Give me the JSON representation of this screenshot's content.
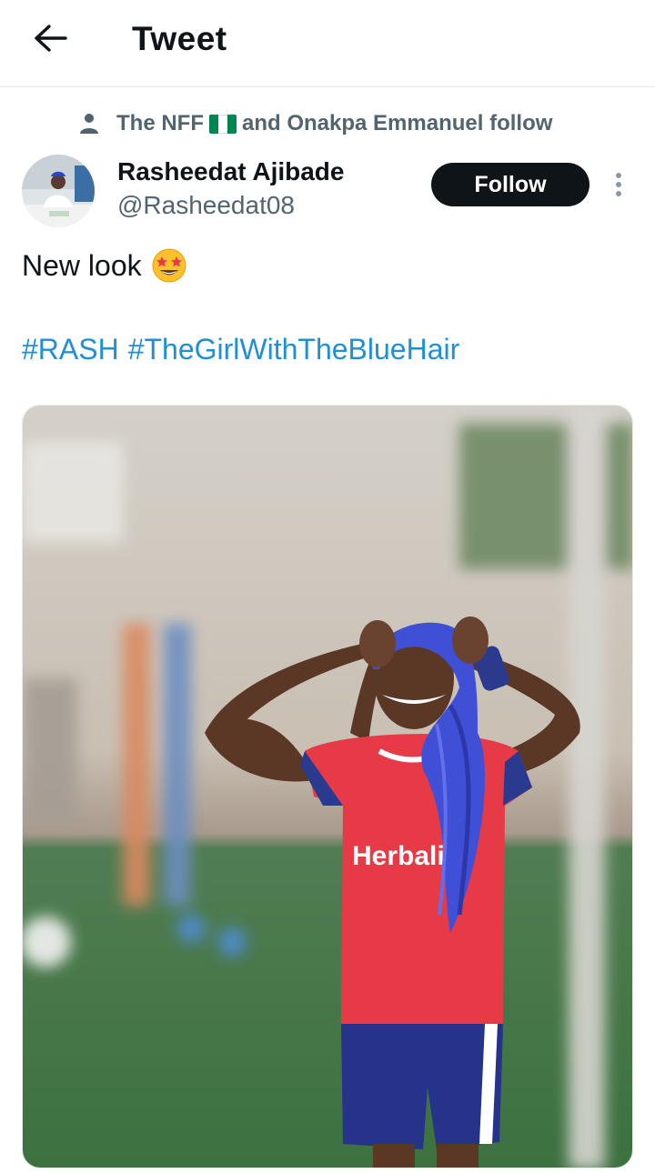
{
  "header": {
    "title": "Tweet",
    "back_icon": "arrow-left-icon"
  },
  "social_context": {
    "icon": "person-icon",
    "prefix": "The NFF",
    "suffix": "and Onakpa Emmanuel follow",
    "flag_colors": [
      "#008751",
      "#ffffff",
      "#008751"
    ]
  },
  "author": {
    "name": "Rasheedat Ajibade",
    "handle": "@Rasheedat08"
  },
  "follow_button": {
    "label": "Follow"
  },
  "more_icon": "more-vertical-icon",
  "tweet": {
    "text": "New look",
    "emoji": "star-struck-emoji",
    "hashtags": [
      "#RASH",
      "#TheGirlWithTheBlueHair"
    ]
  },
  "media": {
    "jersey_text": "Herbalife",
    "colors": {
      "shirt": "#e63a46",
      "shirt_sleeve": "#2a3a8f",
      "shorts": "#25338a",
      "hair": "#3f4fd6",
      "grass": "#3f7a44"
    }
  },
  "colors": {
    "accent": "#1d9bf0",
    "text": "#0f1419",
    "muted": "#536471",
    "button_bg": "#0f1419"
  }
}
